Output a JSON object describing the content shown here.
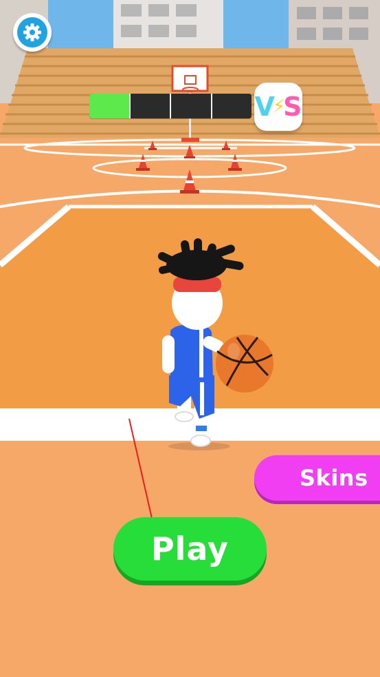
{
  "hud": {
    "settings_icon": "gear-icon",
    "progress": {
      "segments_total": 4,
      "segments_filled": 1,
      "fill_color": "#5de84b",
      "empty_color": "#2b2b2b"
    },
    "vs_badge": {
      "letter_v": "V",
      "letter_s": "S",
      "bolt_icon": "lightning-bolt-icon"
    }
  },
  "buttons": {
    "play_label": "Play",
    "skins_label": "Skins"
  },
  "colors": {
    "play": "#27dd3a",
    "skins": "#f13ef2",
    "settings": "#1fa3e3",
    "court": "#f6a868",
    "arrow": "#e81c1c"
  }
}
